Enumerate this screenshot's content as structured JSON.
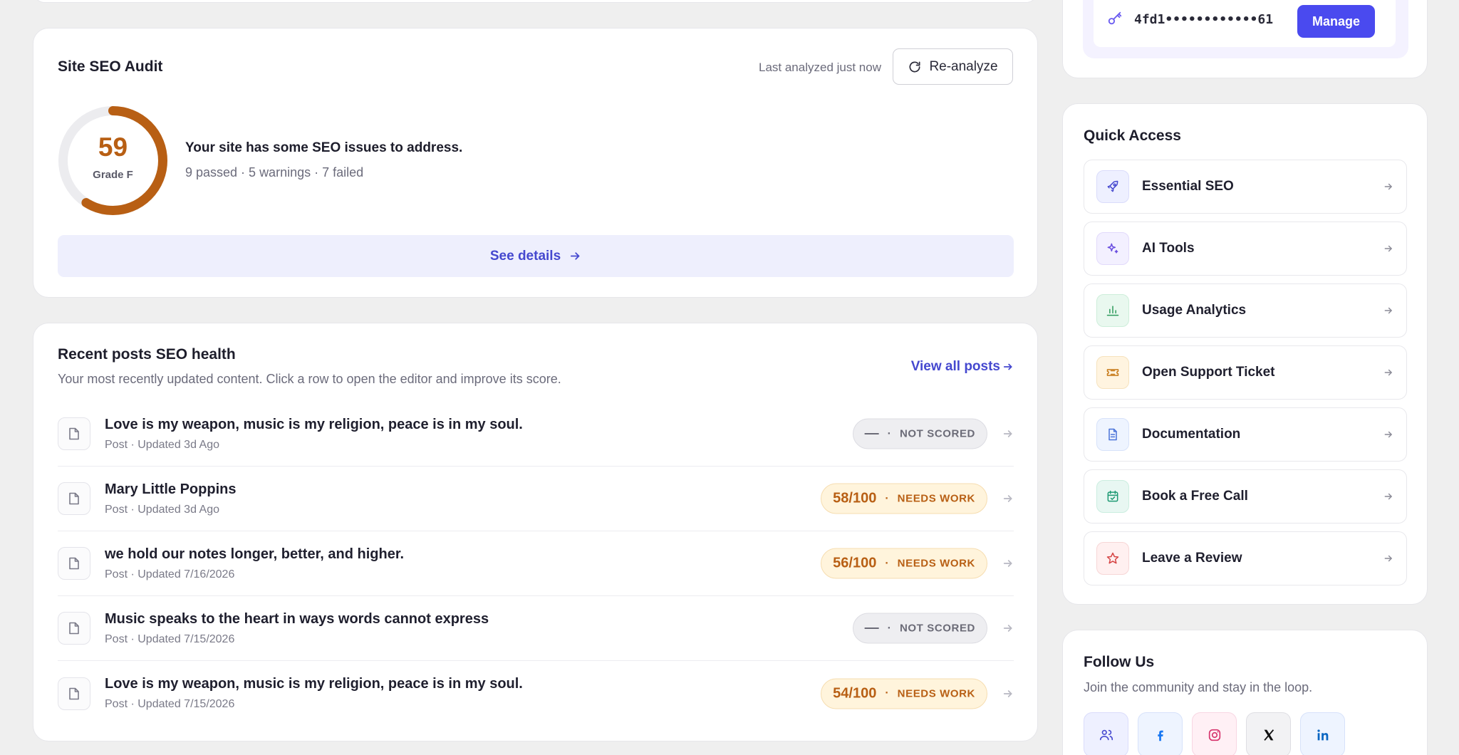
{
  "audit": {
    "title": "Site SEO Audit",
    "last_analyzed": "Last analyzed just now",
    "reanalyze_label": "Re-analyze",
    "score": "59",
    "score_fraction": 0.59,
    "grade": "Grade F",
    "message": "Your site has some SEO issues to address.",
    "summary": "9 passed · 5 warnings · 7 failed",
    "see_details_label": "See details",
    "colors": {
      "gauge": "#b85f14",
      "track": "#ececef",
      "accent": "#4548cf"
    }
  },
  "posts": {
    "title": "Recent posts SEO health",
    "subtitle": "Your most recently updated content. Click a row to open the editor and improve its score.",
    "view_all_label": "View all posts",
    "items": [
      {
        "title": "Love is my weapon, music is my religion, peace is in my soul.",
        "meta": "Post · Updated 3d Ago",
        "score": "—",
        "status": "NOT SCORED",
        "kind": "ns"
      },
      {
        "title": "Mary Little Poppins",
        "meta": "Post · Updated 3d Ago",
        "score": "58/100",
        "status": "NEEDS WORK",
        "kind": "nw"
      },
      {
        "title": "we hold our notes longer, better, and higher.",
        "meta": "Post · Updated 7/16/2026",
        "score": "56/100",
        "status": "NEEDS WORK",
        "kind": "nw"
      },
      {
        "title": "Music speaks to the heart in ways words cannot express",
        "meta": "Post · Updated 7/15/2026",
        "score": "—",
        "status": "NOT SCORED",
        "kind": "ns"
      },
      {
        "title": "Love is my weapon, music is my religion, peace is in my soul.",
        "meta": "Post · Updated 7/15/2026",
        "score": "54/100",
        "status": "NEEDS WORK",
        "kind": "nw"
      }
    ]
  },
  "license": {
    "key_masked": "4fd1••••••••••••61",
    "manage_label": "Manage"
  },
  "quick_access": {
    "title": "Quick Access",
    "items": [
      {
        "label": "Essential SEO",
        "icon": "rocket-icon"
      },
      {
        "label": "AI Tools",
        "icon": "sparkle-icon"
      },
      {
        "label": "Usage Analytics",
        "icon": "bar-chart-icon"
      },
      {
        "label": "Open Support Ticket",
        "icon": "ticket-icon"
      },
      {
        "label": "Documentation",
        "icon": "document-icon"
      },
      {
        "label": "Book a Free Call",
        "icon": "calendar-check-icon"
      },
      {
        "label": "Leave a Review",
        "icon": "star-icon"
      }
    ]
  },
  "follow": {
    "title": "Follow Us",
    "subtitle": "Join the community and stay in the loop.",
    "networks": [
      "community-icon",
      "facebook-icon",
      "instagram-icon",
      "x-icon",
      "linkedin-icon"
    ]
  }
}
